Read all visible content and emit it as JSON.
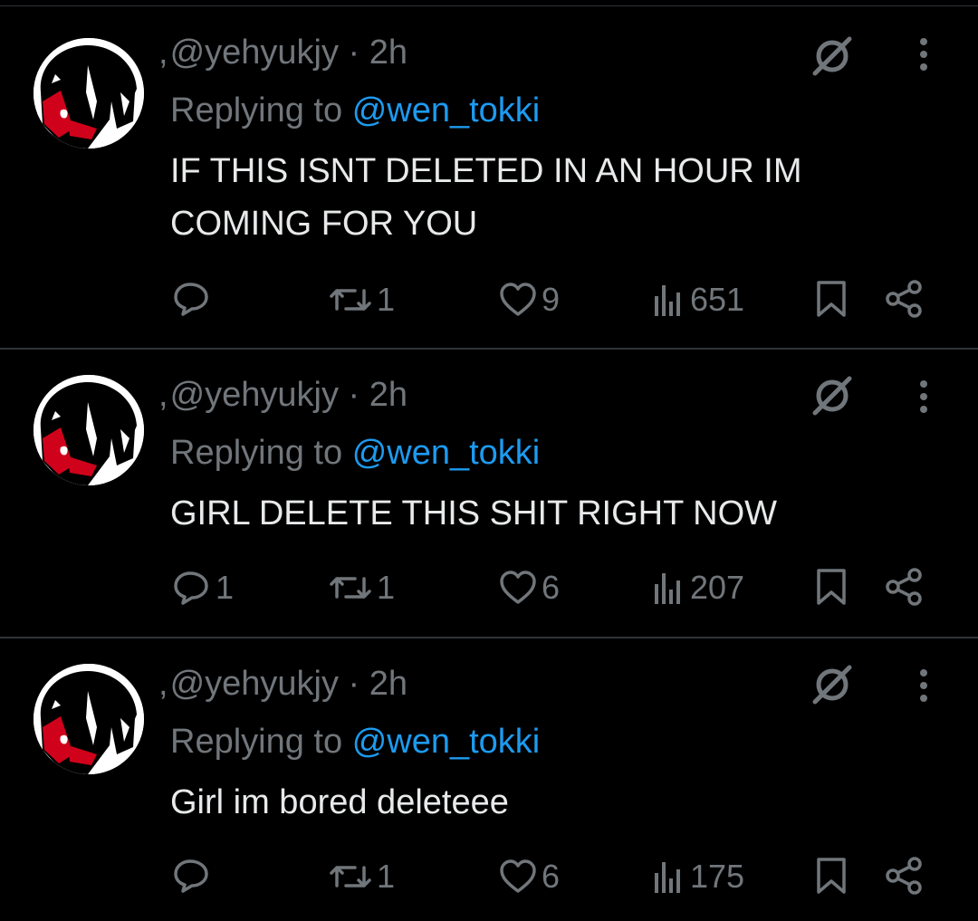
{
  "tweets": [
    {
      "handle": "@yehyukjy",
      "time": "2h",
      "reply_prefix": "Replying to",
      "reply_to": "@wen_tokki",
      "text": "IF THIS ISNT DELETED IN AN HOUR IM COMING FOR YOU",
      "replies": "",
      "reposts": "1",
      "likes": "9",
      "views": "651"
    },
    {
      "handle": "@yehyukjy",
      "time": "2h",
      "reply_prefix": "Replying to",
      "reply_to": "@wen_tokki",
      "text": "GIRL DELETE THIS SHIT RIGHT NOW",
      "replies": "1",
      "reposts": "1",
      "likes": "6",
      "views": "207"
    },
    {
      "handle": "@yehyukjy",
      "time": "2h",
      "reply_prefix": "Replying to",
      "reply_to": "@wen_tokki",
      "text": "Girl im bored deleteee",
      "replies": "",
      "reposts": "1",
      "likes": "6",
      "views": "175"
    }
  ],
  "separator_dot": "·",
  "name_prefix": ",",
  "icons": [
    "reply-icon",
    "repost-icon",
    "like-icon",
    "views-icon",
    "bookmark-icon",
    "share-icon",
    "grok-icon",
    "more-icon"
  ],
  "colors": {
    "background": "#000000",
    "text": "#e7e9ea",
    "muted": "#71767b",
    "link": "#1d9bf0",
    "divider": "#2f3336",
    "avatar_red": "#d0021b"
  }
}
